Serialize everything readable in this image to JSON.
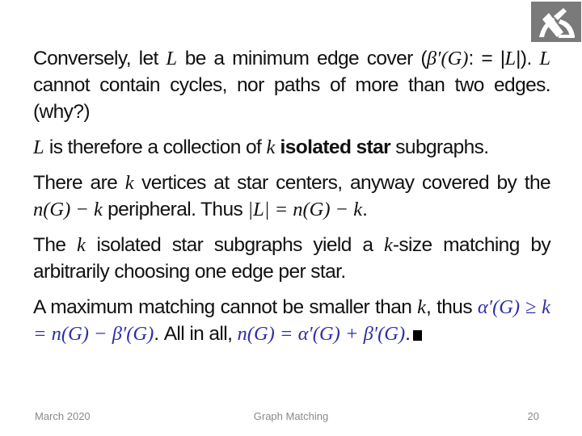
{
  "logo": {
    "icon": "technion-logo-icon",
    "bg_color": "#7a7a7a"
  },
  "slide": {
    "p1": {
      "t1": "Conversely, let ",
      "L": "L",
      "t2": " be a minimum edge cover (",
      "beta": "β′(G)",
      "t3": ": = |",
      "t4": "|). ",
      "t5": " cannot contain cycles, nor paths of more than two edges. (why?)"
    },
    "p2": {
      "L": "L",
      "t1": " is therefore a collection of ",
      "k": "k",
      "bold": "isolated star",
      "t2": " subgraphs."
    },
    "p3": {
      "t1": "There are ",
      "k": "k",
      "t2": " vertices at star centers, anyway covered by the ",
      "m1": "n(G) − k",
      "t3": " peripheral.  Thus ",
      "m2": "|L| = n(G) − k",
      "t4": "."
    },
    "p4": {
      "t1": "The ",
      "k": "k",
      "t2": " isolated star subgraphs yield a ",
      "t3": "-size matching by arbitrarily choosing one edge per star."
    },
    "p5": {
      "t1": "A maximum matching cannot be smaller than ",
      "k": "k",
      "t2": ", thus ",
      "m1": "α′(G) ≥ k = n(G)  −  β′(G)",
      "t3": ". All in all, ",
      "m2": "n(G)  =  α′(G) + β′(G)",
      "t4": "."
    },
    "accent_color": "#2e2ea8"
  },
  "footer": {
    "date": "March 2020",
    "title": "Graph Matching",
    "page": "20"
  }
}
